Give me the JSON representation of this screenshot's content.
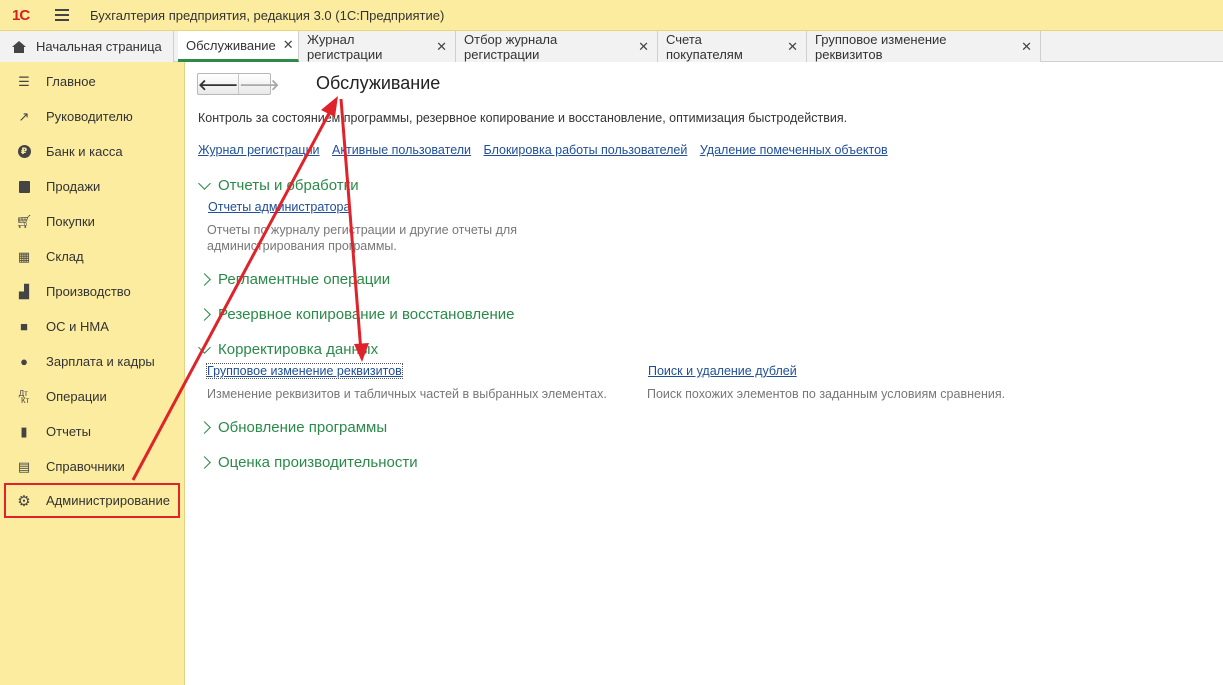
{
  "app": {
    "logo": "1С",
    "title": "Бухгалтерия предприятия, редакция 3.0  (1С:Предприятие)"
  },
  "tabs": [
    {
      "label": "Начальная страница",
      "closable": false
    },
    {
      "label": "Обслуживание",
      "closable": true,
      "active": true
    },
    {
      "label": "Журнал регистрации",
      "closable": true
    },
    {
      "label": "Отбор журнала регистрации",
      "closable": true
    },
    {
      "label": "Счета покупателям",
      "closable": true
    },
    {
      "label": "Групповое изменение реквизитов",
      "closable": true
    }
  ],
  "close_glyph": "✕",
  "sidebar": {
    "items": [
      {
        "label": "Главное",
        "icon": "menu-lines-icon"
      },
      {
        "label": "Руководителю",
        "icon": "trend-icon"
      },
      {
        "label": "Банк и касса",
        "icon": "ruble-coin-icon"
      },
      {
        "label": "Продажи",
        "icon": "shopping-bag-icon"
      },
      {
        "label": "Покупки",
        "icon": "cart-icon"
      },
      {
        "label": "Склад",
        "icon": "warehouse-icon"
      },
      {
        "label": "Производство",
        "icon": "factory-icon"
      },
      {
        "label": "ОС и НМА",
        "icon": "truck-icon"
      },
      {
        "label": "Зарплата и кадры",
        "icon": "person-icon"
      },
      {
        "label": "Операции",
        "icon": "debit-credit-icon"
      },
      {
        "label": "Отчеты",
        "icon": "bar-chart-icon"
      },
      {
        "label": "Справочники",
        "icon": "books-icon"
      },
      {
        "label": "Администрирование",
        "icon": "gear-icon",
        "selected": true
      }
    ]
  },
  "main": {
    "back": "🡐",
    "forward": "🡒",
    "title": "Обслуживание",
    "description": "Контроль за состоянием программы, резервное копирование и восстановление, оптимизация быстродействия.",
    "links": [
      "Журнал регистрации",
      "Активные пользователи",
      "Блокировка работы пользователей",
      "Удаление помеченных объектов"
    ],
    "groups": {
      "reports": {
        "title": "Отчеты и обработки",
        "expanded": true,
        "link": "Отчеты администратора",
        "desc1": "Отчеты по журналу регистрации и другие отчеты для",
        "desc2": "администрирования программы."
      },
      "routine": {
        "title": "Регламентные операции",
        "expanded": false
      },
      "backup": {
        "title": "Резервное копирование и восстановление",
        "expanded": false
      },
      "correction": {
        "title": "Корректировка данных",
        "expanded": true,
        "link1": "Групповое изменение реквизитов",
        "desc1": "Изменение реквизитов и табличных частей в выбранных элементах.",
        "link2": "Поиск и удаление дублей",
        "desc2": "Поиск похожих элементов по заданным условиям сравнения."
      },
      "update": {
        "title": "Обновление программы",
        "expanded": false
      },
      "performance": {
        "title": "Оценка производительности",
        "expanded": false
      }
    }
  },
  "colors": {
    "sidebar_bg": "#fbec9f",
    "group_green": "#2b8a4a",
    "link_blue": "#1f4e9a",
    "annotation_red": "#e0232a"
  }
}
